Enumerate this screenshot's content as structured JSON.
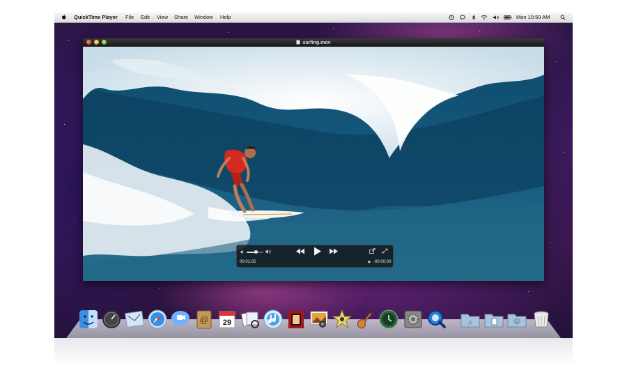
{
  "menubar": {
    "app_name": "QuickTime Player",
    "menus": [
      "File",
      "Edit",
      "View",
      "Share",
      "Window",
      "Help"
    ],
    "clock": "Mon 10:50 AM"
  },
  "window": {
    "title": "surfing.mov"
  },
  "player": {
    "elapsed": "00:01:05",
    "remaining": "-00:00:00",
    "volume_level": 0.55
  },
  "dock": {
    "apps": [
      "Finder",
      "Dashboard",
      "Mail",
      "Safari",
      "iChat",
      "Address Book",
      "iCal",
      "Preview",
      "iTunes",
      "Photo Booth",
      "iPhoto",
      "iMovie",
      "GarageBand",
      "Time Machine",
      "System Preferences",
      "QuickTime Player"
    ],
    "stacks": [
      "Applications",
      "Documents",
      "Downloads"
    ],
    "trash": "Trash",
    "ical_date": "29"
  }
}
